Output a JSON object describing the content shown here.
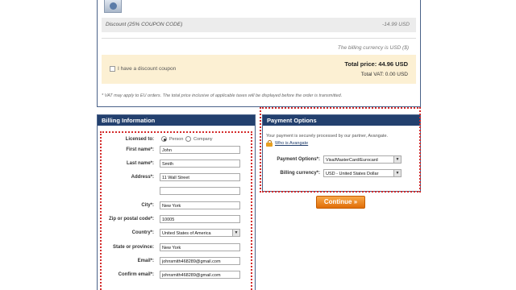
{
  "summary": {
    "discount_label": "Discount (25% COUPON CODE)",
    "discount_amount": "-14.99 USD",
    "currency_note": "The billing currency is USD ($)",
    "coupon_label": "I have a discount coupon",
    "total_price": "Total price: 44.96 USD",
    "total_vat": "Total VAT: 0.00 USD",
    "vat_note": "* VAT may apply to EU orders. The total price inclusive of applicable taxes will be displayed before the order is transmitted."
  },
  "billing": {
    "title": "Billing Information",
    "licensed_to_label": "Licensed to:",
    "person_label": "Person",
    "company_label": "Company",
    "first_name_label": "First name*:",
    "first_name_value": "John",
    "last_name_label": "Last name*:",
    "last_name_value": "Smith",
    "address_label": "Address*:",
    "address_value": "11 Wall Street",
    "address2_value": "",
    "city_label": "City*:",
    "city_value": "New York",
    "zip_label": "Zip or postal code*:",
    "zip_value": "10005",
    "country_label": "Country*:",
    "country_value": "United States of America",
    "state_label": "State or province:",
    "state_value": "New York",
    "email_label": "Email*:",
    "email_value": "johnsmith468289@gmail.com",
    "confirm_email_label": "Confirm email*:",
    "confirm_email_value": "johnsmith468289@gmail.com"
  },
  "payment": {
    "title": "Payment Options",
    "secure_text": "Your payment is securely processed by our partner, Avangate.",
    "who_link": "Who is Avangate",
    "options_label": "Payment Options*:",
    "options_value": "Visa/MasterCard/Eurocard",
    "currency_label": "Billing currency*:",
    "currency_value": "USD - United States Dollar"
  },
  "continue_label": "Continue »",
  "colors": {
    "header_bg": "#23406e",
    "highlight": "#d42a2a",
    "button": "#e06e08",
    "totals_bg": "#fcf0d3"
  }
}
